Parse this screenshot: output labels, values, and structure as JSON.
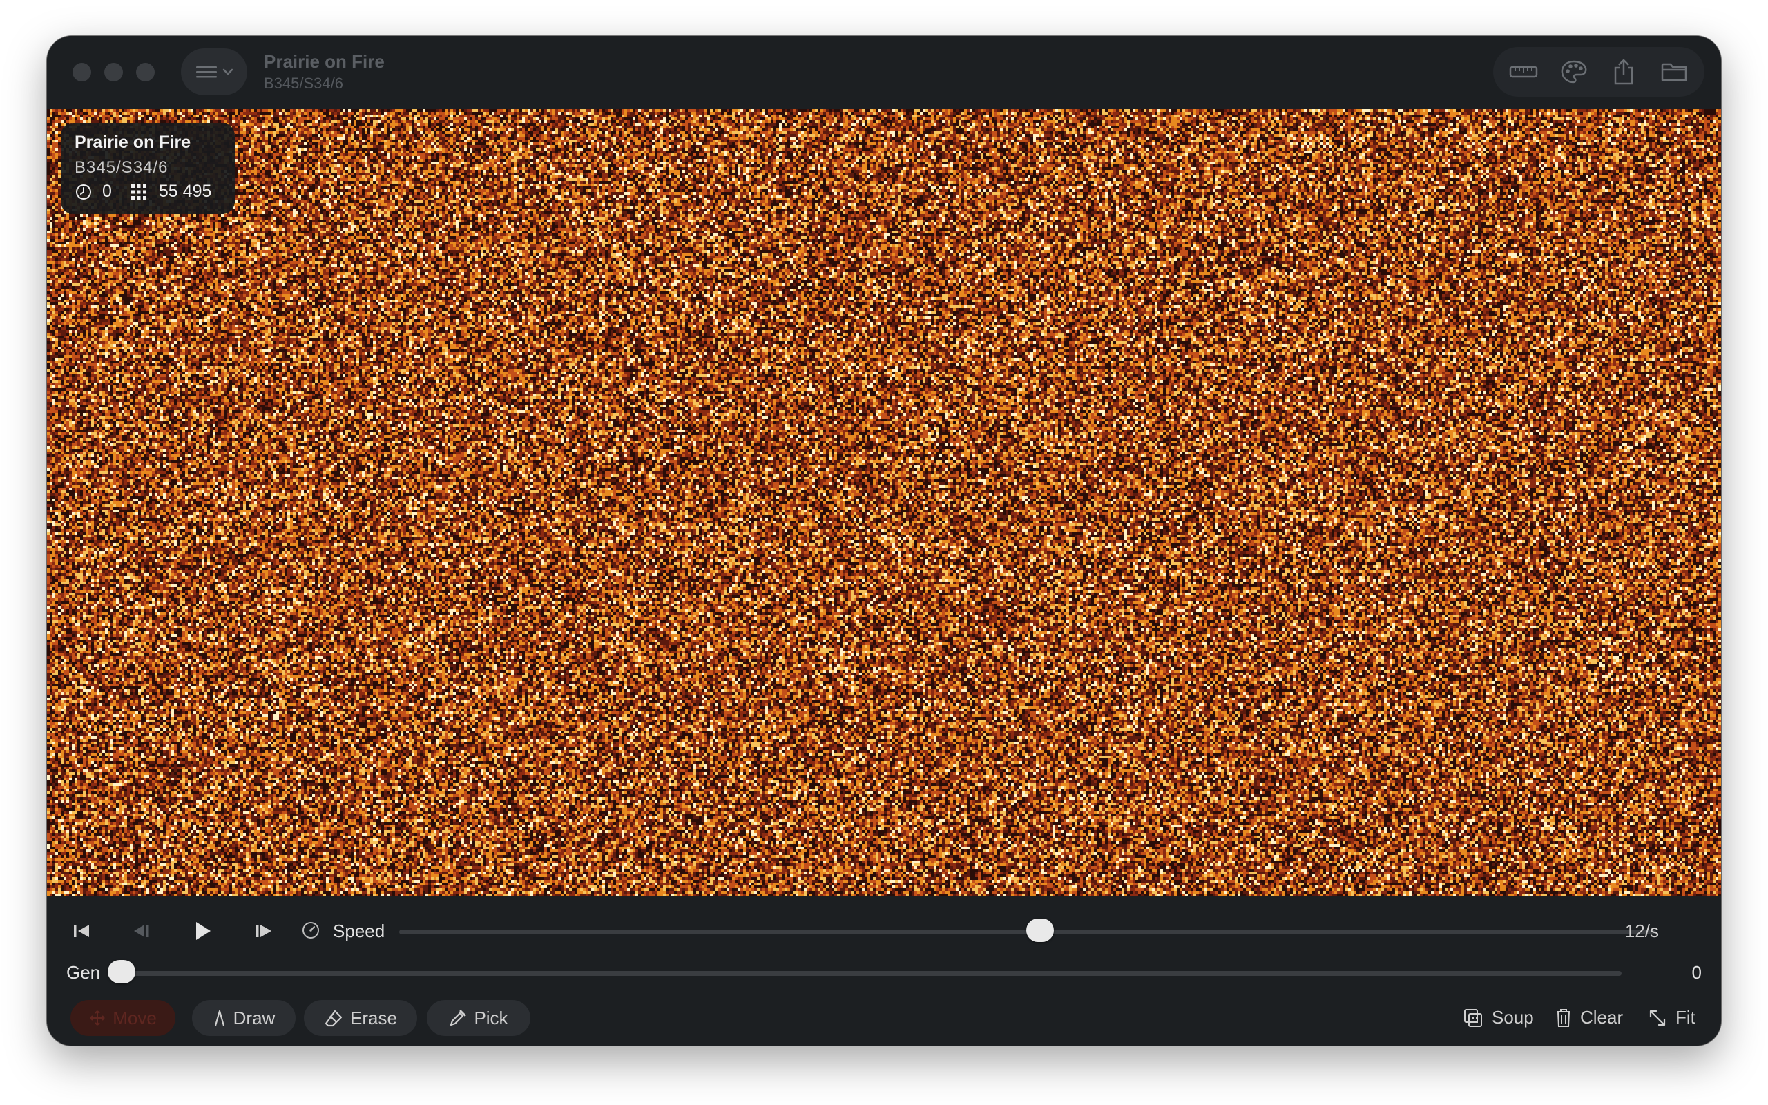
{
  "window": {
    "title": "Prairie on Fire",
    "subtitle": "B345/S34/6"
  },
  "toolbar": {
    "icons": [
      "ruler-icon",
      "palette-icon",
      "share-icon",
      "folder-icon"
    ]
  },
  "info": {
    "title": "Prairie on Fire",
    "rule": "B345/S34/6",
    "generation": "0",
    "population": "55 495"
  },
  "palette": [
    "#2a0d08",
    "#5c1a0e",
    "#8b2a12",
    "#c4501a",
    "#e8891f",
    "#f6c25a",
    "#fff2c6"
  ],
  "playback": {
    "speed_label": "Speed",
    "speed_value": "12/s",
    "speed_fraction": 0.51,
    "gen_label": "Gen",
    "gen_value": "0",
    "gen_fraction": 0.0
  },
  "tools": {
    "move": "Move",
    "draw": "Draw",
    "erase": "Erase",
    "pick": "Pick",
    "soup": "Soup",
    "clear": "Clear",
    "fit": "Fit"
  }
}
